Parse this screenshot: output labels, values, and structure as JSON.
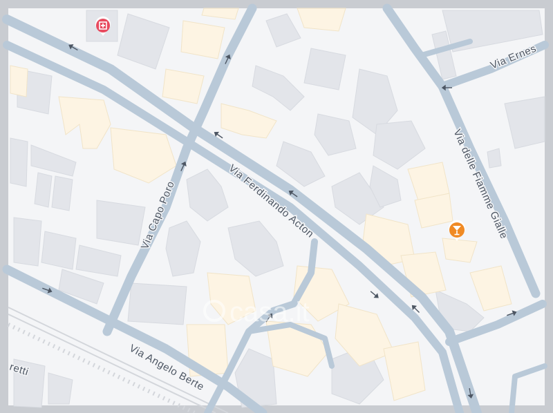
{
  "map": {
    "colors": {
      "frame": "#c9ccd1",
      "land": "#f4f5f7",
      "road": "#b9c9d8",
      "building": "#e3e5ea",
      "building_highlight": "#fdf4e3",
      "arrow": "#4d5663",
      "label": "#4d5663",
      "rail": "#d0d3d8"
    },
    "streets": [
      {
        "name": "Via Ferdinando Acton"
      },
      {
        "name": "Via Capo Poro"
      },
      {
        "name": "Via Angelo Berte"
      },
      {
        "name": "Via delle Fiamme Gialle"
      },
      {
        "name": "Via Ernes"
      },
      {
        "name": "retti"
      }
    ],
    "pois": [
      {
        "type": "hospital",
        "icon": "hospital-cross-icon",
        "color": "#e84a5f"
      },
      {
        "type": "bar",
        "icon": "cocktail-glass-icon",
        "color": "#f08a24"
      }
    ],
    "watermark": {
      "text": "casa.it"
    }
  }
}
